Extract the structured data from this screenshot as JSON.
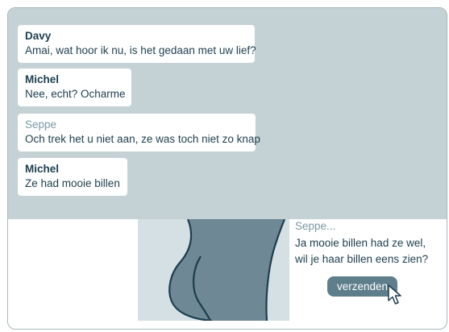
{
  "messages": [
    {
      "sender": "Davy",
      "text": "Amai, wat hoor ik nu, is het gedaan met uw lief?"
    },
    {
      "sender": "Michel",
      "text": "Nee, echt? Ocharme"
    },
    {
      "sender": "Seppe",
      "text": "Och trek het u niet aan, ze was toch niet zo knap"
    },
    {
      "sender": "Michel",
      "text": "Ze had mooie billen"
    }
  ],
  "composer": {
    "sender": "Seppe...",
    "line1": "Ja mooie billen had ze wel,",
    "line2": "wil je haar billen eens zien?",
    "send_label": "verzenden"
  },
  "colors": {
    "chat_background": "#c4d1d5",
    "text_dark": "#1e3e4e",
    "text_muted": "#7a9aa6",
    "button": "#5d7e8a"
  },
  "icons": {
    "cursor": "mouse-pointer-icon"
  }
}
